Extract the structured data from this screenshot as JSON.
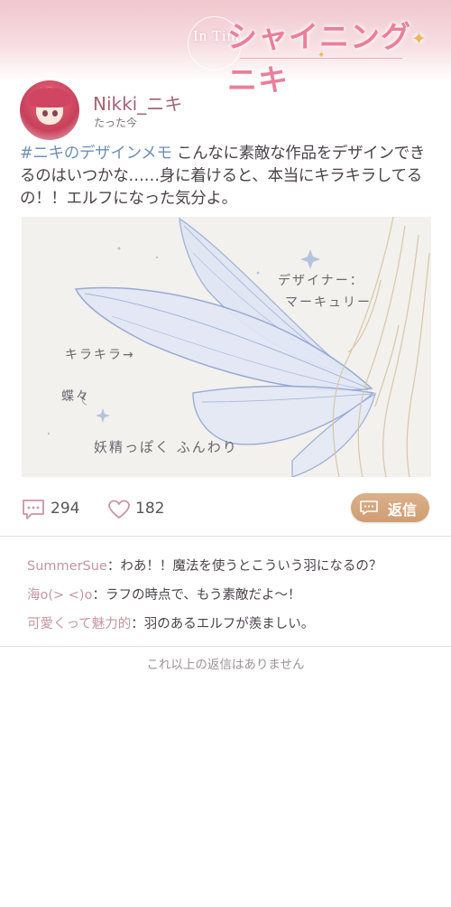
{
  "header": {
    "logo_prefix": "In Tim",
    "logo_title_a": "シャイニング",
    "logo_title_b": "ニキ"
  },
  "post": {
    "username": "Nikki_ニキ",
    "timestamp": "たった今",
    "hashtag": "#ニキのデザインメモ",
    "text": " こんなに素敵な作品をデザインできるのはいつかな……身に着けると、本当にキラキラしてるの！！エルフになった気分よ。",
    "image_notes": {
      "designer": "デザイナー：",
      "designer_name": "マーキュリー",
      "sparkle": "キラキラ→",
      "butterfly": "蝶々",
      "fairy": "妖精っぽく ふんわり"
    }
  },
  "actions": {
    "comment_count": "294",
    "like_count": "182",
    "reply_label": "返信"
  },
  "replies": [
    {
      "author": "SummerSue",
      "sep": "：",
      "text": "わあ！！魔法を使うとこういう羽になるの？"
    },
    {
      "author": "海o(> <)o",
      "sep": "：",
      "text": "ラフの時点で、もう素敵だよ～！"
    },
    {
      "author": "可愛くって魅力的",
      "sep": "：",
      "text": "羽のあるエルフが羨ましい。"
    }
  ],
  "footer": {
    "no_more": "これ以上の返信はありません"
  },
  "colors": {
    "username": "#a36473",
    "hashtag": "#6f8fb5",
    "reply_author": "#c295a2",
    "reply_button": "#d4a57c"
  },
  "icons": {
    "comment": "speech-bubble-icon",
    "like": "heart-icon",
    "reply": "speech-bubble-icon"
  }
}
